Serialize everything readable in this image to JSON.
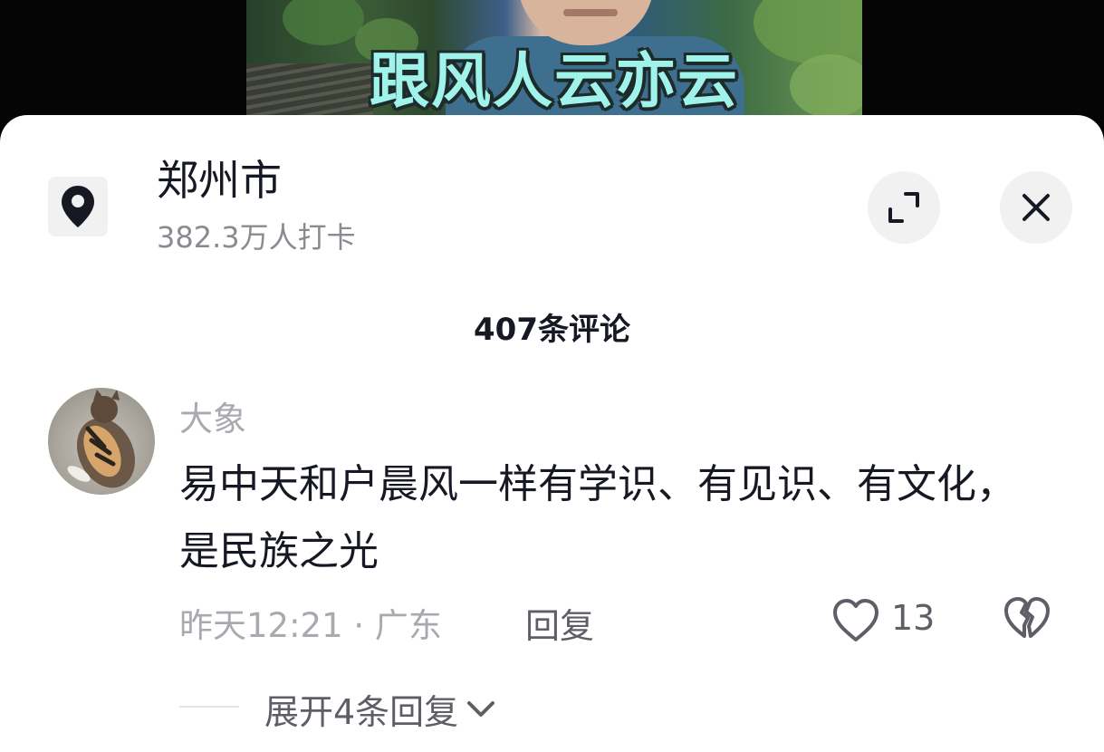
{
  "video": {
    "caption": "跟风人云亦云"
  },
  "location": {
    "title": "郑州市",
    "checkins": "382.3万人打卡",
    "icon": "location-pin-icon"
  },
  "header_actions": {
    "expand_icon": "expand-icon",
    "close_icon": "close-icon"
  },
  "comments_header": {
    "count_label": "407条评论"
  },
  "comment": {
    "username": "大象",
    "text": "易中天和户晨风一样有学识、有见识、有文化，是民族之光",
    "meta": "昨天12:21 · 广东",
    "reply_label": "回复",
    "like_count": "13",
    "expand_replies_label": "展开4条回复"
  },
  "colors": {
    "caption_fill": "#9ff3ea",
    "primary_text": "#161823",
    "secondary_text": "#a9aaaf",
    "action_text": "#5e5f66",
    "button_bg": "#f1f1f2"
  }
}
